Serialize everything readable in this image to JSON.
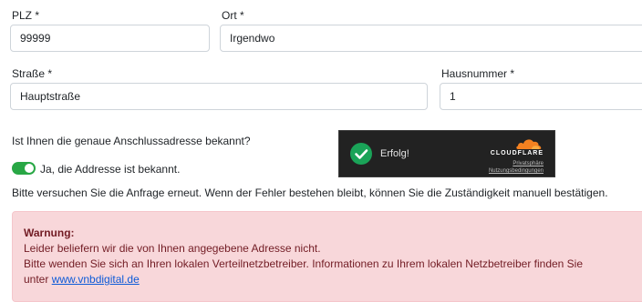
{
  "form": {
    "plz": {
      "label": "PLZ *",
      "value": "99999"
    },
    "ort": {
      "label": "Ort *",
      "value": "Irgendwo"
    },
    "strasse": {
      "label": "Straße *",
      "value": "Hauptstraße"
    },
    "hausnummer": {
      "label": "Hausnummer *",
      "value": "1"
    }
  },
  "address_question": "Ist Ihnen die genaue Anschlussadresse bekannt?",
  "toggle": {
    "label": "Ja, die Addresse ist bekannt.",
    "checked": true
  },
  "captcha": {
    "status": "Erfolg!",
    "brand": "CLOUDFLARE",
    "privacy": "Privatsphäre",
    "terms": "Nutzungsbedingungen",
    "icon": "check-circle-icon",
    "logo": "cloudflare-cloud-icon"
  },
  "retry_message": "Bitte versuchen Sie die Anfrage erneut. Wenn der Fehler bestehen bleibt, können Sie die Zuständigkeit manuell bestätigen.",
  "warning": {
    "title": "Warnung:",
    "line1": "Leider beliefern wir die von Ihnen angegebene Adresse nicht.",
    "line2": "Bitte wenden Sie sich an Ihren lokalen Verteilnetzbetreiber. Informationen zu Ihrem lokalen Netzbetreiber finden Sie",
    "line3_prefix": "unter",
    "link": "www.vnbdigital.de"
  },
  "colors": {
    "toggle_on": "#28a745",
    "warning_bg": "#f8d7da",
    "warning_text": "#721c24",
    "cloudflare_orange": "#f48120",
    "success_green": "#1aa358"
  }
}
